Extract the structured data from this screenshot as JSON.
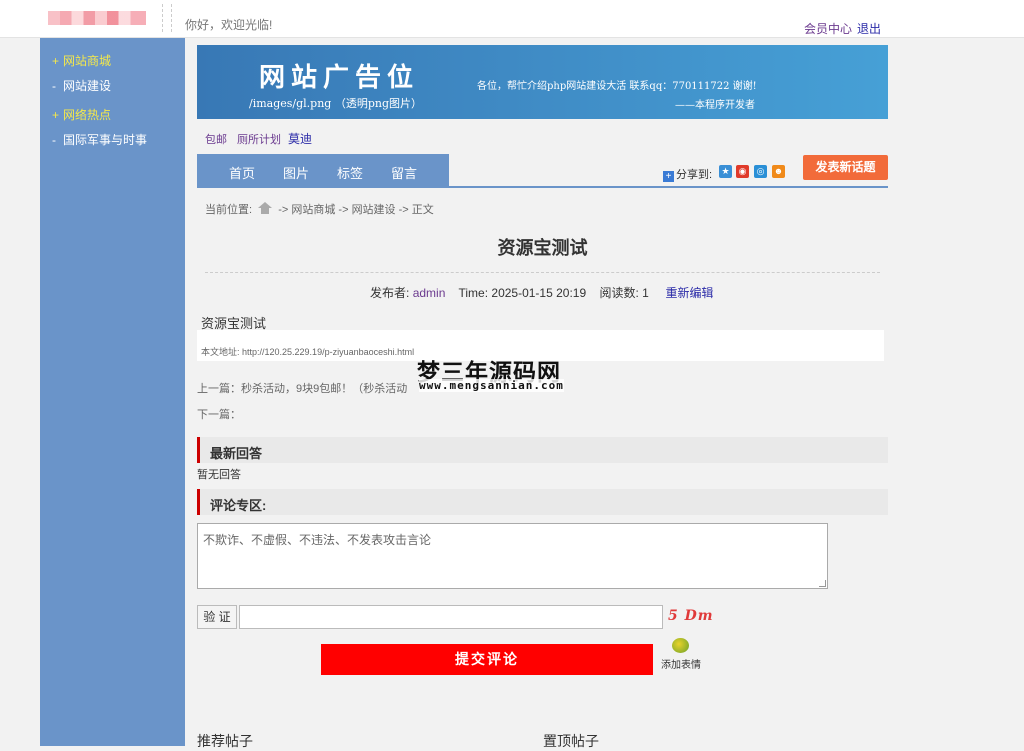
{
  "header": {
    "welcome": "你好，欢迎光临!",
    "member_center": "会员中心",
    "logout": "退出"
  },
  "sidebar": {
    "items": [
      {
        "mark": "+",
        "label": "网站商城",
        "highlight": true
      },
      {
        "mark": "-",
        "label": "网站建设",
        "highlight": false
      },
      {
        "mark": "+",
        "label": "网络热点",
        "highlight": true
      },
      {
        "mark": "-",
        "label": "国际军事与时事",
        "highlight": false
      }
    ]
  },
  "banner": {
    "title": "网站广告位",
    "path": "/images/gl.png （透明png图片）",
    "message": "各位，帮忙介绍php网站建设大活  联系qq：770111722 谢谢!",
    "developer": "——本程序开发者"
  },
  "quick_links": [
    "包邮",
    "厕所计划",
    "莫迪"
  ],
  "nav": {
    "items": [
      "首页",
      "图片",
      "标签",
      "留言"
    ],
    "share_label": "分享到:",
    "new_post": "发表新话题"
  },
  "breadcrumb": {
    "prefix": "当前位置:",
    "items": [
      "网站商城",
      "网站建设",
      "正文"
    ],
    "sep": "->"
  },
  "article": {
    "title": "资源宝测试",
    "publisher_label": "发布者:",
    "publisher": "admin",
    "time": "Time: 2025-01-15 20:19",
    "reads": "阅读数: 1",
    "reedit": "重新编辑",
    "content": "资源宝测试",
    "url": "本文地址:   http://120.25.229.19/p-ziyuanbaoceshi.html",
    "prev": "上一篇：秒杀活动，9块9包邮！（秒杀活动",
    "next": "下一篇："
  },
  "watermark": {
    "title": "梦三年源码网",
    "url": "www.mengsannian.com"
  },
  "replies": {
    "title": "最新回答",
    "empty": "暂无回答"
  },
  "comments": {
    "title": "评论专区:",
    "placeholder": "不欺诈、不虚假、不违法、不发表攻击言论",
    "verify_label": "验 证",
    "captcha": "5 Dm",
    "submit": "提交评论",
    "emoji_label": "添加表情"
  },
  "bottom": {
    "recommended": "推荐帖子",
    "pinned": "置顶帖子"
  },
  "colors": {
    "sidebar": "#6a94c9",
    "sidebar_highlight": "#f5e94a",
    "accent_red": "#ff0000",
    "new_post": "#f26b3a"
  }
}
